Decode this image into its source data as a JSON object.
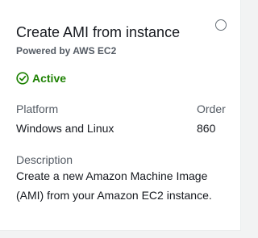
{
  "card": {
    "title": "Create AMI from instance",
    "subtitle": "Powered by AWS EC2",
    "status": "Active",
    "platform_label": "Platform",
    "platform_value": "Windows and Linux",
    "order_label": "Order",
    "order_value": "860",
    "description_label": "Description",
    "description_text": "Create a new Amazon Machine Image (AMI) from your Amazon EC2 instance.",
    "selected": false
  },
  "colors": {
    "status_active": "#1d8102",
    "title_text": "#16191f",
    "muted_text": "#545b64",
    "radio_border": "#687078",
    "page_background": "#f2f3f3",
    "card_background": "#ffffff"
  },
  "icons": {
    "status": "check-circle-icon",
    "select": "radio-button"
  }
}
